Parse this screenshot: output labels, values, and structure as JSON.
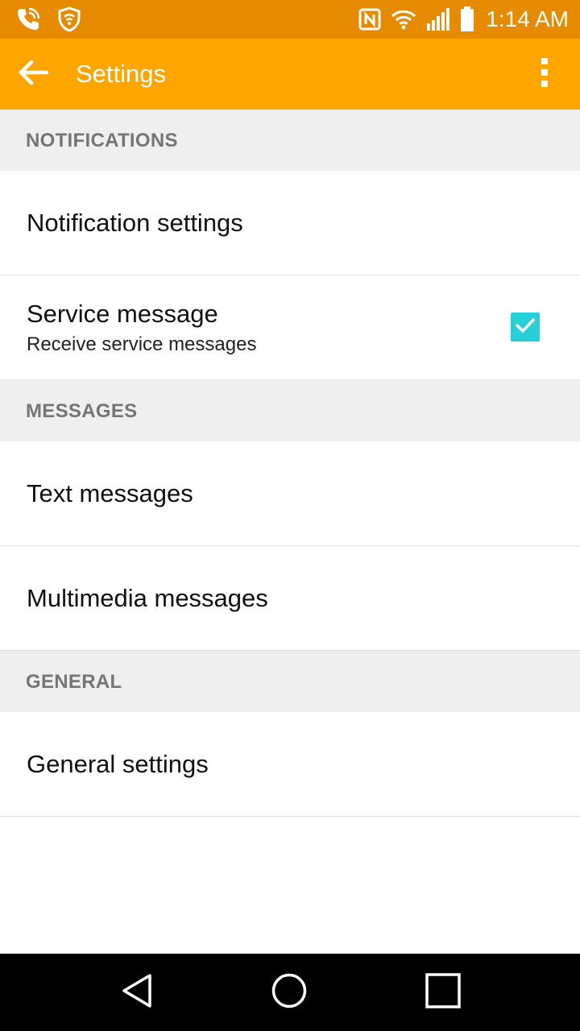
{
  "status_bar": {
    "time": "1:14 AM",
    "left_icons": [
      "call-icon",
      "vpn-shield-icon"
    ],
    "right_icons": [
      "nfc-icon",
      "wifi-icon",
      "signal-icon",
      "battery-icon"
    ]
  },
  "app_bar": {
    "title": "Settings",
    "back_icon": "arrow-back-icon",
    "overflow_icon": "more-vert-icon",
    "color": "#ffa500"
  },
  "sections": {
    "notifications": {
      "header": "NOTIFICATIONS",
      "items": [
        {
          "title": "Notification settings"
        },
        {
          "title": "Service message",
          "summary": "Receive service messages",
          "checked": true
        }
      ]
    },
    "messages": {
      "header": "MESSAGES",
      "items": [
        {
          "title": "Text messages"
        },
        {
          "title": "Multimedia messages"
        }
      ]
    },
    "general": {
      "header": "GENERAL",
      "items": [
        {
          "title": "General settings"
        }
      ]
    }
  },
  "colors": {
    "status_bar": "#e68a00",
    "accent_checkbox": "#26d0d8",
    "section_header_bg": "#efefef",
    "section_header_text": "#757575"
  },
  "nav_bar": {
    "buttons": [
      "nav-back-icon",
      "nav-home-icon",
      "nav-recents-icon"
    ]
  }
}
